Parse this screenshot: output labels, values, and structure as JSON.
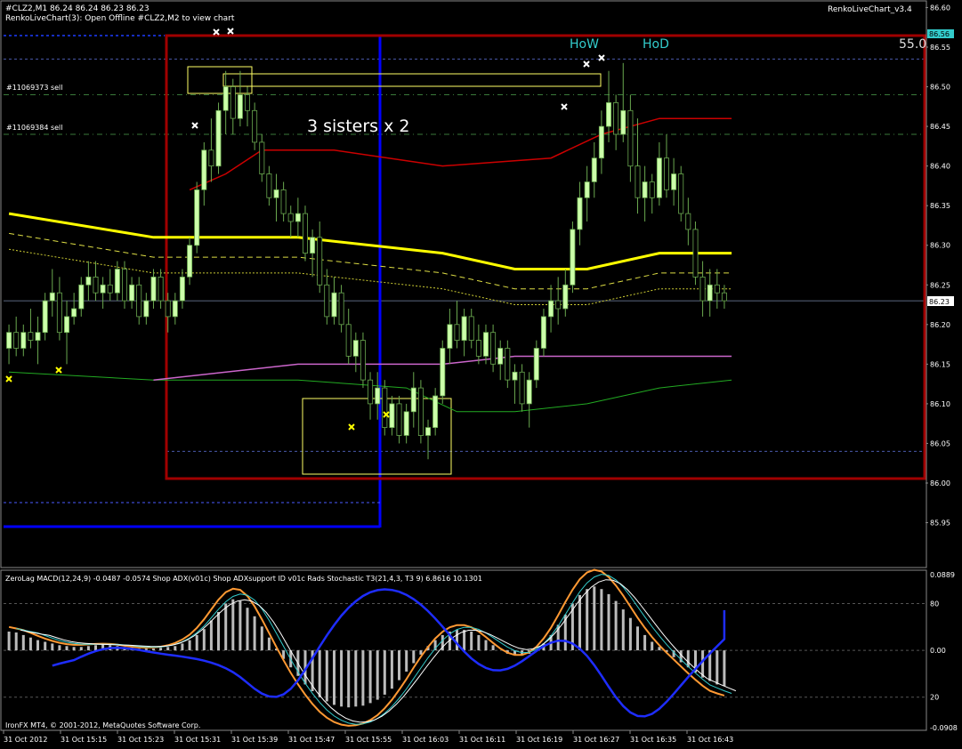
{
  "window": {
    "symbol_line": "#CLZ2,M1  86.24 86.24 86.23 86.23",
    "subtitle": "RenkoLiveChart(3): Open Offline #CLZ2,M2 to view chart",
    "indicator_name": "RenkoLiveChart_v3.4",
    "copyright": "IronFX MT4, © 2001-2012, MetaQuotes Software Corp."
  },
  "annotations": {
    "pattern_label": "3 sisters x 2",
    "how": "HoW",
    "hod": "HoD",
    "corner_value": "55.0",
    "order1": "#11069373 sell",
    "order2": "#11069384 sell"
  },
  "price_panel": {
    "price_axis": [
      "86.60",
      "86.55",
      "86.50",
      "86.45",
      "86.40",
      "86.35",
      "86.30",
      "86.25",
      "86.20",
      "86.15",
      "86.10",
      "86.05",
      "86.00",
      "85.95"
    ],
    "current_price": "86.23",
    "high_tag": "86.56"
  },
  "indicator_panel": {
    "header": "ZeroLag MACD(12,24,9) -0.0487 -0.0574  Shop ADX(v01c)  Shop ADXsupport ID v01c  Rads Stochastic T3(21,4,3, T3 9) 6.8616 10.1301",
    "axis": [
      "0.0889",
      "80",
      "0.00",
      "20",
      "-0.0908"
    ]
  },
  "time_axis": [
    "31 Oct 2012",
    "31 Oct 15:15",
    "31 Oct 15:23",
    "31 Oct 15:31",
    "31 Oct 15:39",
    "31 Oct 15:47",
    "31 Oct 15:55",
    "31 Oct 16:03",
    "31 Oct 16:11",
    "31 Oct 16:19",
    "31 Oct 16:27",
    "31 Oct 16:35",
    "31 Oct 16:43"
  ],
  "colors": {
    "background": "#000000",
    "bull_candle": "#ccffaa",
    "bear_candle": "#000000",
    "wick": "#6aa84f",
    "red_box": "#a00000",
    "blue_box": "#0000ff",
    "yellow_box": "#ffff66",
    "ma_yellow": "#ffff00",
    "ma_red": "#cc0000",
    "ma_green": "#22aa22",
    "ma_magenta": "#cc66cc",
    "macd_orange": "#ff9933",
    "adx_blue": "#1e2dff",
    "histogram": "#bbbbbb",
    "label_cyan": "#33cccc"
  },
  "chart_data": {
    "type": "candlestick",
    "symbol": "#CLZ2",
    "timeframe": "M1",
    "ylim": [
      85.92,
      86.62
    ],
    "bar_count": 100,
    "candles": [
      [
        86.17,
        86.2,
        86.15,
        86.19
      ],
      [
        86.19,
        86.21,
        86.16,
        86.17
      ],
      [
        86.17,
        86.2,
        86.16,
        86.19
      ],
      [
        86.19,
        86.22,
        86.17,
        86.18
      ],
      [
        86.18,
        86.21,
        86.15,
        86.19
      ],
      [
        86.19,
        86.24,
        86.18,
        86.23
      ],
      [
        86.23,
        86.27,
        86.21,
        86.24
      ],
      [
        86.24,
        86.26,
        86.18,
        86.19
      ],
      [
        86.19,
        86.23,
        86.15,
        86.21
      ],
      [
        86.21,
        86.24,
        86.2,
        86.22
      ],
      [
        86.22,
        86.26,
        86.21,
        86.25
      ],
      [
        86.25,
        86.28,
        86.23,
        86.26
      ],
      [
        86.26,
        86.28,
        86.23,
        86.24
      ],
      [
        86.24,
        86.26,
        86.22,
        86.25
      ],
      [
        86.25,
        86.27,
        86.23,
        86.24
      ],
      [
        86.24,
        86.28,
        86.23,
        86.27
      ],
      [
        86.27,
        86.28,
        86.22,
        86.23
      ],
      [
        86.23,
        86.26,
        86.22,
        86.25
      ],
      [
        86.25,
        86.26,
        86.2,
        86.21
      ],
      [
        86.21,
        86.24,
        86.2,
        86.23
      ],
      [
        86.23,
        86.27,
        86.22,
        86.26
      ],
      [
        86.26,
        86.27,
        86.22,
        86.23
      ],
      [
        86.23,
        86.24,
        86.19,
        86.21
      ],
      [
        86.21,
        86.24,
        86.2,
        86.23
      ],
      [
        86.23,
        86.27,
        86.22,
        86.26
      ],
      [
        86.26,
        86.31,
        86.25,
        86.3
      ],
      [
        86.3,
        86.38,
        86.29,
        86.37
      ],
      [
        86.37,
        86.43,
        86.35,
        86.42
      ],
      [
        86.42,
        86.46,
        86.38,
        86.4
      ],
      [
        86.4,
        86.48,
        86.39,
        86.47
      ],
      [
        86.47,
        86.52,
        86.44,
        86.5
      ],
      [
        86.5,
        86.51,
        86.44,
        86.46
      ],
      [
        86.46,
        86.52,
        86.45,
        86.49
      ],
      [
        86.49,
        86.5,
        86.45,
        86.47
      ],
      [
        86.47,
        86.48,
        86.42,
        86.43
      ],
      [
        86.43,
        86.44,
        86.38,
        86.39
      ],
      [
        86.39,
        86.4,
        86.35,
        86.36
      ],
      [
        86.36,
        86.39,
        86.33,
        86.37
      ],
      [
        86.37,
        86.38,
        86.33,
        86.34
      ],
      [
        86.34,
        86.35,
        86.31,
        86.33
      ],
      [
        86.33,
        86.36,
        86.31,
        86.34
      ],
      [
        86.34,
        86.35,
        86.28,
        86.29
      ],
      [
        86.29,
        86.32,
        86.26,
        86.31
      ],
      [
        86.31,
        86.33,
        86.24,
        86.25
      ],
      [
        86.25,
        86.27,
        86.2,
        86.21
      ],
      [
        86.21,
        86.26,
        86.2,
        86.24
      ],
      [
        86.24,
        86.25,
        86.19,
        86.2
      ],
      [
        86.2,
        86.22,
        86.15,
        86.16
      ],
      [
        86.16,
        86.19,
        86.14,
        86.18
      ],
      [
        86.18,
        86.19,
        86.12,
        86.13
      ],
      [
        86.13,
        86.14,
        86.08,
        86.1
      ],
      [
        86.1,
        86.14,
        86.08,
        86.12
      ],
      [
        86.12,
        86.13,
        86.06,
        86.07
      ],
      [
        86.07,
        86.11,
        86.06,
        86.1
      ],
      [
        86.1,
        86.11,
        86.05,
        86.06
      ],
      [
        86.06,
        86.1,
        86.05,
        86.09
      ],
      [
        86.09,
        86.14,
        86.07,
        86.12
      ],
      [
        86.12,
        86.13,
        86.05,
        86.06
      ],
      [
        86.06,
        86.08,
        86.03,
        86.07
      ],
      [
        86.07,
        86.12,
        86.06,
        86.11
      ],
      [
        86.11,
        86.18,
        86.1,
        86.17
      ],
      [
        86.17,
        86.22,
        86.15,
        86.2
      ],
      [
        86.2,
        86.23,
        86.17,
        86.18
      ],
      [
        86.18,
        86.22,
        86.16,
        86.21
      ],
      [
        86.21,
        86.22,
        86.17,
        86.18
      ],
      [
        86.18,
        86.2,
        86.15,
        86.16
      ],
      [
        86.16,
        86.2,
        86.15,
        86.19
      ],
      [
        86.19,
        86.2,
        86.14,
        86.15
      ],
      [
        86.15,
        86.18,
        86.13,
        86.17
      ],
      [
        86.17,
        86.18,
        86.12,
        86.13
      ],
      [
        86.13,
        86.15,
        86.1,
        86.14
      ],
      [
        86.14,
        86.15,
        86.09,
        86.1
      ],
      [
        86.1,
        86.14,
        86.07,
        86.13
      ],
      [
        86.13,
        86.18,
        86.12,
        86.17
      ],
      [
        86.17,
        86.22,
        86.16,
        86.21
      ],
      [
        86.21,
        86.25,
        86.19,
        86.23
      ],
      [
        86.23,
        86.26,
        86.2,
        86.22
      ],
      [
        86.22,
        86.27,
        86.21,
        86.25
      ],
      [
        86.25,
        86.33,
        86.24,
        86.32
      ],
      [
        86.32,
        86.38,
        86.3,
        86.36
      ],
      [
        86.36,
        86.4,
        86.33,
        86.38
      ],
      [
        86.38,
        86.43,
        86.36,
        86.41
      ],
      [
        86.41,
        86.47,
        86.39,
        86.45
      ],
      [
        86.45,
        86.52,
        86.43,
        86.48
      ],
      [
        86.48,
        86.49,
        86.42,
        86.44
      ],
      [
        86.44,
        86.53,
        86.43,
        86.47
      ],
      [
        86.47,
        86.49,
        86.38,
        86.4
      ],
      [
        86.4,
        86.46,
        86.34,
        86.36
      ],
      [
        86.36,
        86.4,
        86.33,
        86.38
      ],
      [
        86.38,
        86.39,
        86.34,
        86.36
      ],
      [
        86.36,
        86.43,
        86.35,
        86.41
      ],
      [
        86.41,
        86.44,
        86.36,
        86.37
      ],
      [
        86.37,
        86.41,
        86.35,
        86.39
      ],
      [
        86.39,
        86.4,
        86.33,
        86.34
      ],
      [
        86.34,
        86.36,
        86.3,
        86.32
      ],
      [
        86.32,
        86.33,
        86.25,
        86.26
      ],
      [
        86.26,
        86.28,
        86.21,
        86.23
      ],
      [
        86.23,
        86.27,
        86.21,
        86.25
      ],
      [
        86.25,
        86.27,
        86.22,
        86.24
      ],
      [
        86.24,
        86.25,
        86.22,
        86.23
      ]
    ],
    "ma_yellow": [
      [
        0,
        86.34
      ],
      [
        20,
        86.31
      ],
      [
        40,
        86.31
      ],
      [
        60,
        86.29
      ],
      [
        70,
        86.27
      ],
      [
        80,
        86.27
      ],
      [
        90,
        86.29
      ],
      [
        100,
        86.29
      ]
    ],
    "ma_red": [
      [
        25,
        86.37
      ],
      [
        30,
        86.39
      ],
      [
        35,
        86.42
      ],
      [
        45,
        86.42
      ],
      [
        60,
        86.4
      ],
      [
        75,
        86.41
      ],
      [
        82,
        86.44
      ],
      [
        90,
        86.46
      ],
      [
        100,
        86.46
      ]
    ],
    "ma_green": [
      [
        0,
        86.14
      ],
      [
        20,
        86.13
      ],
      [
        40,
        86.13
      ],
      [
        55,
        86.12
      ],
      [
        62,
        86.09
      ],
      [
        70,
        86.09
      ],
      [
        80,
        86.1
      ],
      [
        90,
        86.12
      ],
      [
        100,
        86.13
      ]
    ],
    "ma_magenta": [
      [
        20,
        86.13
      ],
      [
        40,
        86.15
      ],
      [
        60,
        86.15
      ],
      [
        70,
        86.16
      ],
      [
        80,
        86.16
      ],
      [
        100,
        86.16
      ]
    ],
    "macd_histogram": [
      0.022,
      0.021,
      0.018,
      0.015,
      0.012,
      0.01,
      0.008,
      0.006,
      0.005,
      0.004,
      0.004,
      0.005,
      0.006,
      0.007,
      0.006,
      0.005,
      0.004,
      0.003,
      0.002,
      0.002,
      0.002,
      0.003,
      0.004,
      0.005,
      0.008,
      0.012,
      0.018,
      0.025,
      0.035,
      0.045,
      0.055,
      0.06,
      0.058,
      0.05,
      0.04,
      0.028,
      0.015,
      0.002,
      -0.01,
      -0.02,
      -0.03,
      -0.04,
      -0.048,
      -0.055,
      -0.06,
      -0.064,
      -0.066,
      -0.067,
      -0.066,
      -0.065,
      -0.062,
      -0.058,
      -0.052,
      -0.045,
      -0.035,
      -0.025,
      -0.015,
      -0.005,
      0.005,
      0.012,
      0.018,
      0.022,
      0.024,
      0.024,
      0.022,
      0.018,
      0.012,
      0.006,
      0.0,
      -0.004,
      -0.006,
      -0.006,
      -0.004,
      0.0,
      0.008,
      0.018,
      0.03,
      0.042,
      0.055,
      0.065,
      0.072,
      0.075,
      0.072,
      0.066,
      0.058,
      0.048,
      0.038,
      0.028,
      0.018,
      0.01,
      0.004,
      -0.002,
      -0.008,
      -0.014,
      -0.02,
      -0.026,
      -0.032,
      -0.036,
      -0.04,
      -0.042
    ],
    "price_levels": {
      "order_sell_1": 86.49,
      "order_sell_2": 86.44,
      "current": 86.23,
      "high": 86.56
    }
  }
}
